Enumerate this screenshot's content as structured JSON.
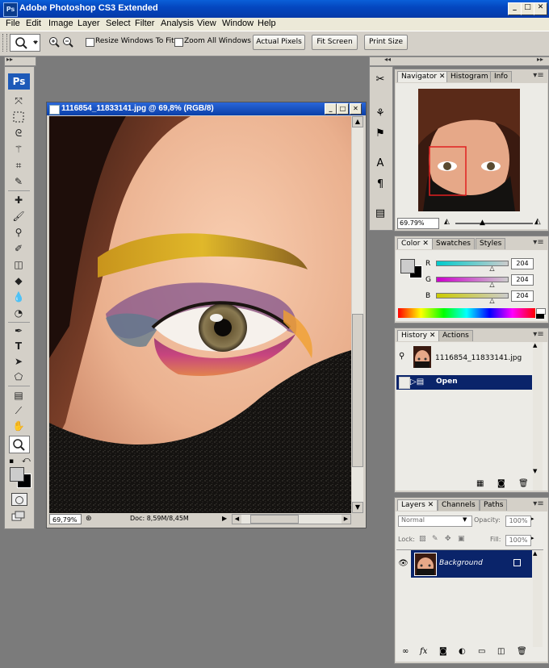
{
  "app": {
    "title": "Adobe Photoshop CS3 Extended",
    "logo": "Ps"
  },
  "window_controls": {
    "minimize": "_",
    "maximize": "□",
    "close": "✕"
  },
  "menu": [
    "File",
    "Edit",
    "Image",
    "Layer",
    "Select",
    "Filter",
    "Analysis",
    "View",
    "Window",
    "Help"
  ],
  "options": {
    "resize_label": "Resize Windows To Fit",
    "zoom_all_label": "Zoom All Windows",
    "actual_pixels": "Actual Pixels",
    "fit_screen": "Fit Screen",
    "print_size": "Print Size"
  },
  "toolbox": {
    "logo": "Ps"
  },
  "document": {
    "title": "1116854_11833141.jpg @ 69,8% (RGB/8)",
    "zoom": "69,79%",
    "doc_info": "Doc: 8,59M/8,45M"
  },
  "navigator": {
    "tabs": [
      "Navigator",
      "Histogram",
      "Info"
    ],
    "zoom": "69.79%"
  },
  "color": {
    "tabs": [
      "Color",
      "Swatches",
      "Styles"
    ],
    "channels": [
      {
        "label": "R",
        "value": "204"
      },
      {
        "label": "G",
        "value": "204"
      },
      {
        "label": "B",
        "value": "204"
      }
    ],
    "slider_level": 0.8
  },
  "history": {
    "tabs": [
      "History",
      "Actions"
    ],
    "snapshot": "1116854_11833141.jpg",
    "items": [
      "Open"
    ]
  },
  "layers": {
    "tabs": [
      "Layers",
      "Channels",
      "Paths"
    ],
    "blend_mode": "Normal",
    "opacity_label": "Opacity:",
    "opacity": "100%",
    "lock_label": "Lock:",
    "fill_label": "Fill:",
    "fill": "100%",
    "layer_name": "Background"
  },
  "colors": {
    "accent": "#0a246a",
    "title_blue": "#0447c0"
  }
}
